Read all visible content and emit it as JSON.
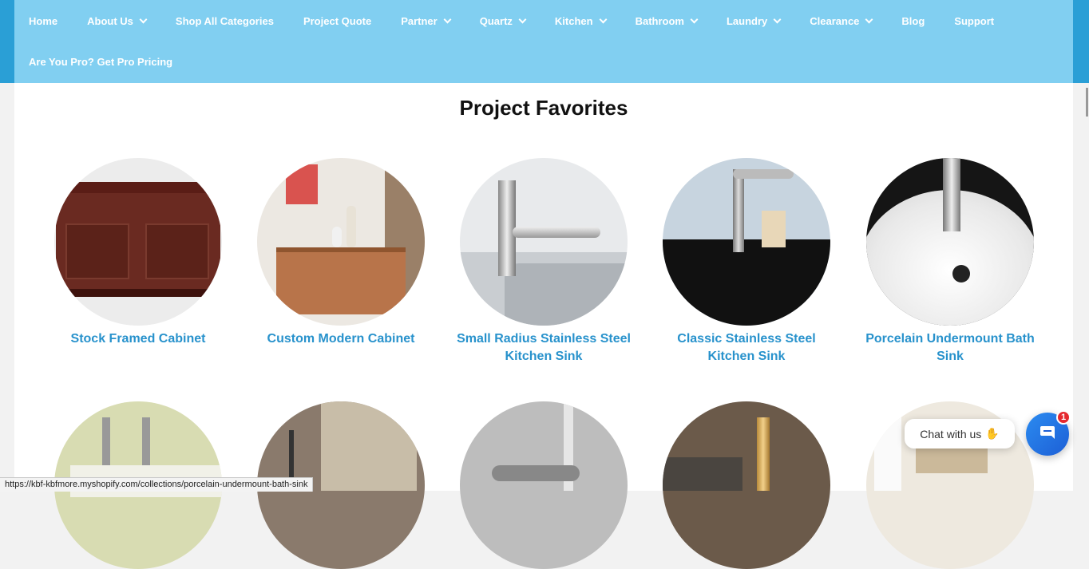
{
  "nav": {
    "items": [
      {
        "label": "Home",
        "dropdown": false
      },
      {
        "label": "About Us",
        "dropdown": true
      },
      {
        "label": "Shop All Categories",
        "dropdown": false
      },
      {
        "label": "Project Quote",
        "dropdown": false
      },
      {
        "label": "Partner",
        "dropdown": true
      },
      {
        "label": "Quartz",
        "dropdown": true
      },
      {
        "label": "Kitchen",
        "dropdown": true
      },
      {
        "label": "Bathroom",
        "dropdown": true
      },
      {
        "label": "Laundry",
        "dropdown": true
      },
      {
        "label": "Clearance",
        "dropdown": true
      },
      {
        "label": "Blog",
        "dropdown": false
      },
      {
        "label": "Support",
        "dropdown": false
      }
    ],
    "pro_link": "Are You Pro? Get Pro Pricing"
  },
  "section": {
    "title": "Project Favorites",
    "products": [
      {
        "label": "Stock Framed Cabinet",
        "image": "brown-wood-cabinet"
      },
      {
        "label": "Custom Modern Cabinet",
        "image": "wood-sideboard"
      },
      {
        "label": "Small Radius Stainless Steel Kitchen Sink",
        "image": "chrome-faucet-steel-sink"
      },
      {
        "label": "Classic Stainless Steel Kitchen Sink",
        "image": "black-sink-faucet"
      },
      {
        "label": "Porcelain Undermount Bath Sink",
        "image": "white-porcelain-sink"
      }
    ],
    "products_row2": [
      {
        "image": "faucet-row"
      },
      {
        "image": "bathroom-window-tap"
      },
      {
        "image": "steel-handle"
      },
      {
        "image": "gold-faucet-kitchen"
      },
      {
        "image": "white-bathroom-vanity"
      }
    ]
  },
  "status_bar": {
    "url": "https://kbf-kbfmore.myshopify.com/collections/porcelain-undermount-bath-sink"
  },
  "chat": {
    "bubble_text": "Chat with us",
    "wave_icon": "waving-hand-icon",
    "badge_count": "1"
  },
  "colors": {
    "nav_bg": "#81cff1",
    "edge_bg": "#2a9fd6",
    "link": "#2892cc",
    "chat": "#1d5fd6"
  }
}
